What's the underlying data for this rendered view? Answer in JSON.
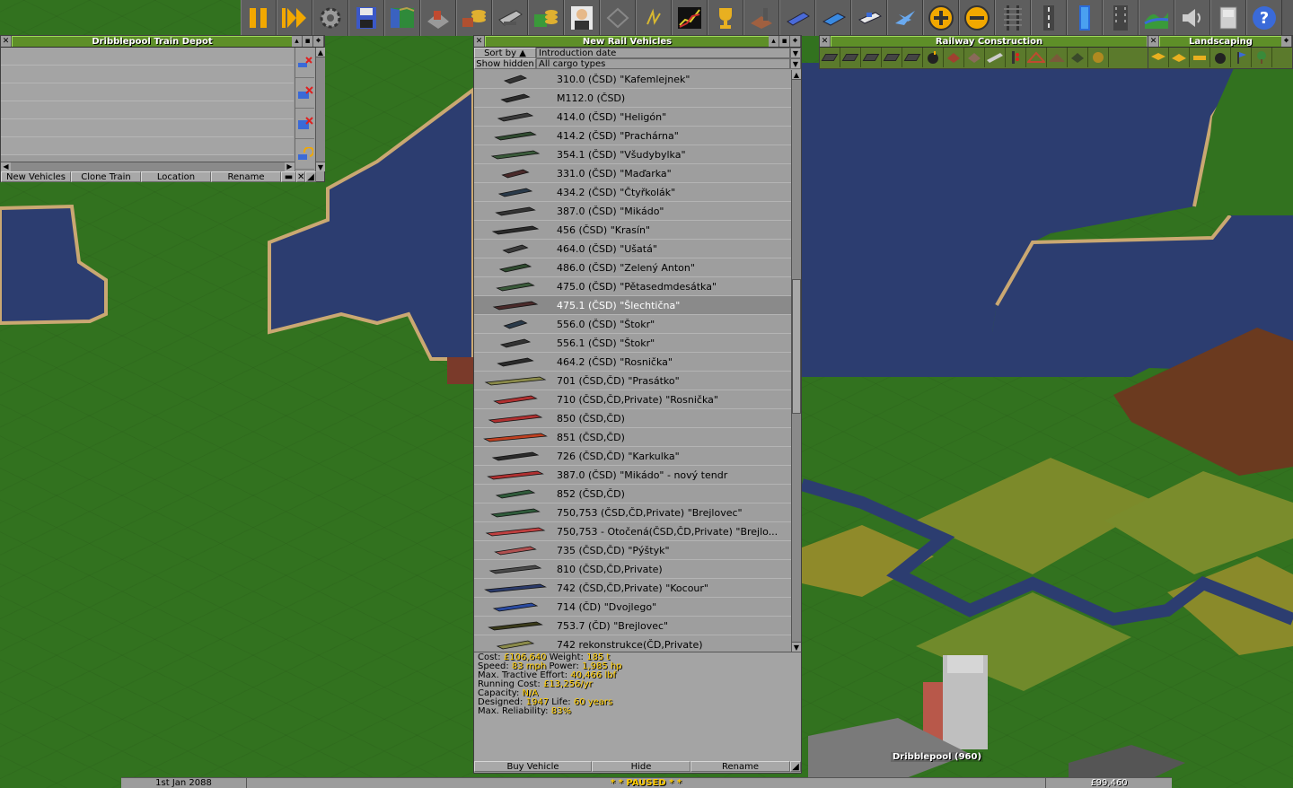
{
  "depot": {
    "title": "Dribblepool Train Depot",
    "buttons": [
      "New Vehicles",
      "Clone Train",
      "Location",
      "Rename"
    ]
  },
  "rail_vehicles": {
    "title": "New Rail Vehicles",
    "sort_label": "Sort by",
    "sort_value": "Introduction date",
    "hidden_label": "Show hidden",
    "cargo_value": "All cargo types",
    "items": [
      "310.0 (ČSD) \"Kafemlejnek\"",
      "M112.0 (ČSD)",
      "414.0 (ČSD) \"Heligón\"",
      "414.2 (ČSD) \"Prachárna\"",
      "354.1 (ČSD) \"Všudybylka\"",
      "331.0 (ČSD) \"Maďarka\"",
      "434.2 (ČSD) \"Čtyřkolák\"",
      "387.0 (ČSD) \"Mikádo\"",
      "456 (ČSD) \"Krasín\"",
      "464.0 (ČSD) \"Ušatá\"",
      "486.0 (ČSD) \"Zelený Anton\"",
      "475.0 (ČSD) \"Pětasedmdesátka\"",
      "475.1 (ČSD) \"Šlechtična\"",
      "556.0 (ČSD) \"Štokr\"",
      "556.1 (ČSD) \"Štokr\"",
      "464.2 (ČSD) \"Rosnička\"",
      "701 (ČSD,ČD) \"Prasátko\"",
      "710 (ČSD,ČD,Private) \"Rosnička\"",
      "850 (ČSD,ČD)",
      "851 (ČSD,ČD)",
      "726 (ČSD,ČD) \"Karkulka\"",
      "387.0 (ČSD) \"Mikádo\" - nový tendr",
      "852 (ČSD,ČD)",
      "750,753 (ČSD,ČD,Private) \"Brejlovec\"",
      "750,753 - Otočená(ČSD,ČD,Private) \"Brejlo...",
      "735 (ČSD,ČD) \"Pýštyk\"",
      "810 (ČSD,ČD,Private)",
      "742 (ČSD,ČD,Private) \"Kocour\"",
      "714 (ČD) \"Dvojlego\"",
      "753.7 (ČD) \"Brejlovec\"",
      "742 rekonstrukce(ČD,Private)"
    ],
    "selected_index": 12,
    "info": {
      "cost_label": "Cost:",
      "cost": "£106,640",
      "weight_label": "Weight:",
      "weight": "185 t",
      "speed_label": "Speed:",
      "speed": "83 mph",
      "power_label": "Power:",
      "power": "1,985 hp",
      "te_label": "Max. Tractive Effort:",
      "te": "40,466 lbf",
      "running_label": "Running Cost:",
      "running": "£13,256/yr",
      "capacity_label": "Capacity:",
      "capacity": "N/A",
      "designed_label": "Designed:",
      "designed": "1947",
      "life_label": "Life:",
      "life": "60 years",
      "reliability_label": "Max. Reliability:",
      "reliability": "83%"
    },
    "buttons": [
      "Buy Vehicle",
      "Hide",
      "Rename"
    ]
  },
  "railway_construction": {
    "title": "Railway Construction"
  },
  "landscaping": {
    "title": "Landscaping"
  },
  "status": {
    "date": "1st Jan 2088",
    "paused": "* * PAUSED * *",
    "money": "£99,460"
  },
  "town": {
    "label": "Dribblepool (960)"
  },
  "toolbar_icons": [
    "pause-icon",
    "fast-forward-icon",
    "settings-icon",
    "save-icon",
    "map-icon",
    "town-directory-icon",
    "subsidies-icon",
    "station-list-icon",
    "finances-icon",
    "company-icon",
    "story-book-icon",
    "goals-icon",
    "graphs-icon",
    "league-table-icon",
    "industries-icon",
    "train-list-icon",
    "road-vehicle-list-icon",
    "ship-list-icon",
    "aircraft-list-icon",
    "zoom-in-icon",
    "zoom-out-icon",
    "build-railway-icon",
    "build-road-icon",
    "build-tram-icon",
    "build-water-icon",
    "build-airport-icon",
    "landscaping-icon",
    "music-icon",
    "messages-icon",
    "help-icon"
  ]
}
